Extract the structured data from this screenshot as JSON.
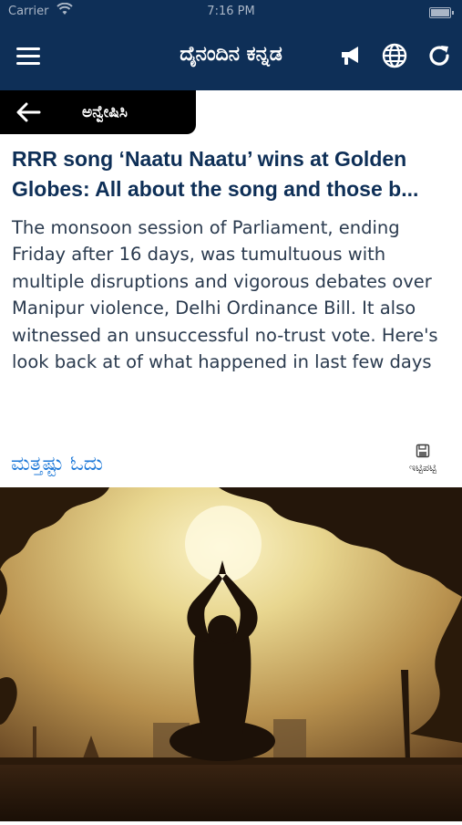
{
  "status_bar": {
    "carrier": "Carrier",
    "time": "7:16 PM"
  },
  "header": {
    "title": "ದೈನಂದಿನ ಕನ್ನಡ",
    "icons": [
      "menu-icon",
      "megaphone-icon",
      "globe-icon",
      "refresh-icon"
    ]
  },
  "search_bar": {
    "label": "ಅನ್ವೇಷಿಸಿ",
    "back_icon": "arrow-left-icon"
  },
  "article": {
    "headline": "RRR song ‘Naatu Naatu’ wins at Golden Globes: All about the song and those b...",
    "summary": "The monsoon session of Parliament, ending Friday after 16 days, was tumultuous with multiple disruptions and vigorous debates over Manipur violence, Delhi Ordinance Bill. It also witnessed an unsuccessful no-trust vote. Here's look back at of what happened in last few days",
    "read_more": "ಮತ್ತಷ್ಟು ಓದು",
    "save_label": "ಇಟ್ಟಿಪಟ್ಟಿ",
    "save_icon": "floppy-disk-icon"
  },
  "colors": {
    "header_bg": "#0e2f57",
    "link": "#1c78d8",
    "headline": "#0e2f57"
  }
}
